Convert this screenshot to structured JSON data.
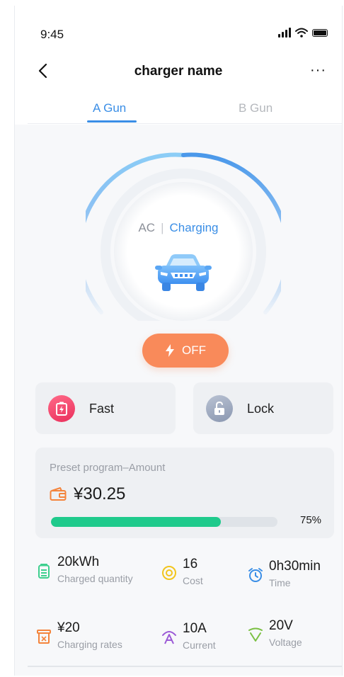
{
  "status_bar": {
    "time": "9:45"
  },
  "header": {
    "title": "charger name",
    "more": "···"
  },
  "tabs": [
    {
      "label": "A Gun",
      "active": true
    },
    {
      "label": "B Gun",
      "active": false
    }
  ],
  "gauge": {
    "type_label": "AC",
    "separator": "|",
    "status_label": "Charging",
    "accent": "#3a8ee6"
  },
  "power_button": {
    "label": "OFF",
    "color": "#f98a5a"
  },
  "modes": [
    {
      "label": "Fast",
      "icon": "fast-charge-icon",
      "color": "#f0406a"
    },
    {
      "label": "Lock",
      "icon": "unlock-icon",
      "color": "#9aa6bd"
    }
  ],
  "preset": {
    "title": "Preset program–Amount",
    "amount": "¥30.25",
    "progress_percent": 75,
    "progress_label": "75%",
    "progress_color": "#1fca8c"
  },
  "stats": [
    {
      "value": "20kWh",
      "label": "Charged quantity",
      "icon": "battery-icon",
      "color": "#3ecf8e"
    },
    {
      "value": "16",
      "label": "Cost",
      "icon": "coin-icon",
      "color": "#f2c51d"
    },
    {
      "value": "0h30min",
      "label": "Time",
      "icon": "alarm-clock-icon",
      "color": "#3a8ee6"
    },
    {
      "value": "¥20",
      "label": "Charging rates",
      "icon": "rate-ticket-icon",
      "color": "#f4843c"
    },
    {
      "value": "10A",
      "label": "Current",
      "icon": "current-icon",
      "color": "#9b59d6"
    },
    {
      "value": "20V",
      "label": "Voltage",
      "icon": "voltage-icon",
      "color": "#7bc043"
    }
  ]
}
